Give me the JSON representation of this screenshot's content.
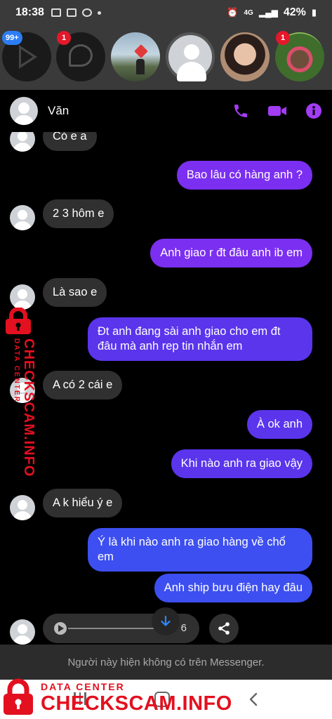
{
  "status_bar": {
    "time": "18:38",
    "battery": "42%",
    "network": "4G"
  },
  "chat_heads": {
    "badges": [
      "99+",
      "1",
      "1"
    ]
  },
  "header": {
    "contact_name": "Văn",
    "accent_color": "#a33cf5"
  },
  "messages": [
    {
      "direction": "in",
      "text": "Có e a"
    },
    {
      "direction": "out",
      "text": "Bao lâu có hàng anh ?"
    },
    {
      "direction": "in",
      "text": "2 3 hôm e"
    },
    {
      "direction": "out",
      "text": "Anh giao r đt đâu anh ib em"
    },
    {
      "direction": "in",
      "text": "Là sao e"
    },
    {
      "direction": "out",
      "text": "Đt anh đang sài anh giao cho em đt đâu mà anh rep tin nhắn em"
    },
    {
      "direction": "in",
      "text": "A có 2 cái e"
    },
    {
      "direction": "out",
      "text": "À ok anh"
    },
    {
      "direction": "out",
      "text": "Khi nào anh ra giao vậy"
    },
    {
      "direction": "in",
      "text": "A k hiểu ý e"
    },
    {
      "direction": "out",
      "text": "Ý là khi nào anh ra giao hàng về chổ em"
    },
    {
      "direction": "out",
      "text": "Anh ship bưu điện hay đâu"
    }
  ],
  "audio": {
    "duration": "6"
  },
  "footer": {
    "note": "Người này hiện không có trên Messenger."
  },
  "watermark": {
    "small": "DATA CENTER",
    "big": "CHECKSCAM.INFO"
  },
  "colors": {
    "bubble_in": "#303030",
    "bubble_out_top": "#7b2ff0",
    "bubble_out_bottom": "#3d4ff0"
  }
}
